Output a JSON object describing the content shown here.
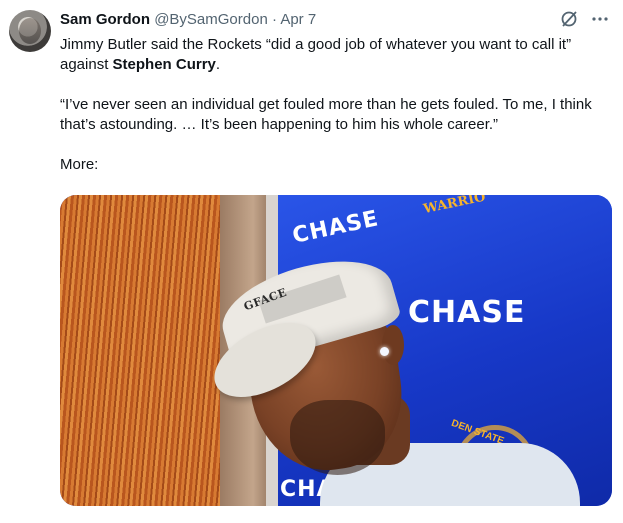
{
  "author": {
    "name": "Sam Gordon",
    "handle": "@BySamGordon",
    "separator": "·",
    "date": "Apr 7"
  },
  "tweet": {
    "line1_a": "Jimmy Butler said the Rockets “did a good job of whatever you want to call it” against ",
    "line1_bold": "Stephen Curry",
    "line1_b": ".",
    "quote": "“I’ve never seen an individual get fouled more than he gets fouled. To me, I think that’s astounding. … It’s been happening to him his whole career.”",
    "more": "More:"
  },
  "media": {
    "sign_text_1": "CHASE",
    "sign_text_2": "CHASE",
    "sign_text_3": "CHA",
    "team_text": "WARRIO",
    "team_text_2": "DEN STATE",
    "cap_text": "GFACE",
    "colors": {
      "board": "#1738c7",
      "gold": "#f6b42c"
    }
  },
  "icons": {
    "grok": "grok-slash-icon",
    "more": "more-dots-icon"
  }
}
